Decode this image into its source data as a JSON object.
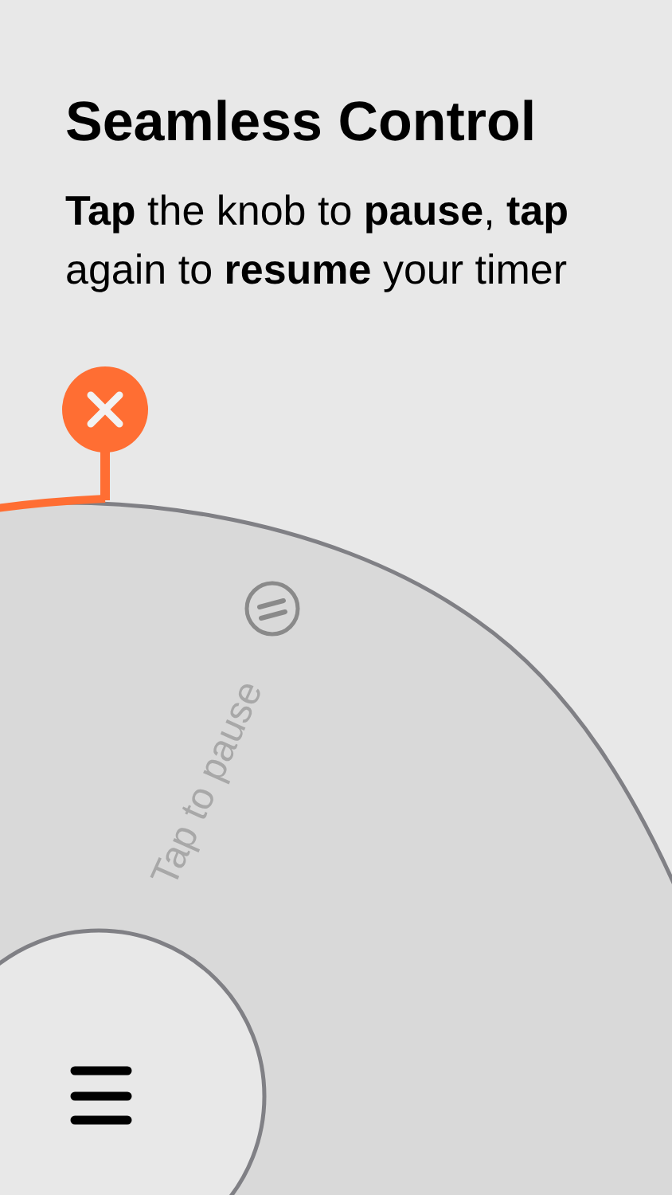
{
  "headline": "Seamless Control",
  "description": "**Tap** the knob to **pause**, **tap** again to **resume** your timer",
  "knob": {
    "hint": "Tap to pause"
  }
}
